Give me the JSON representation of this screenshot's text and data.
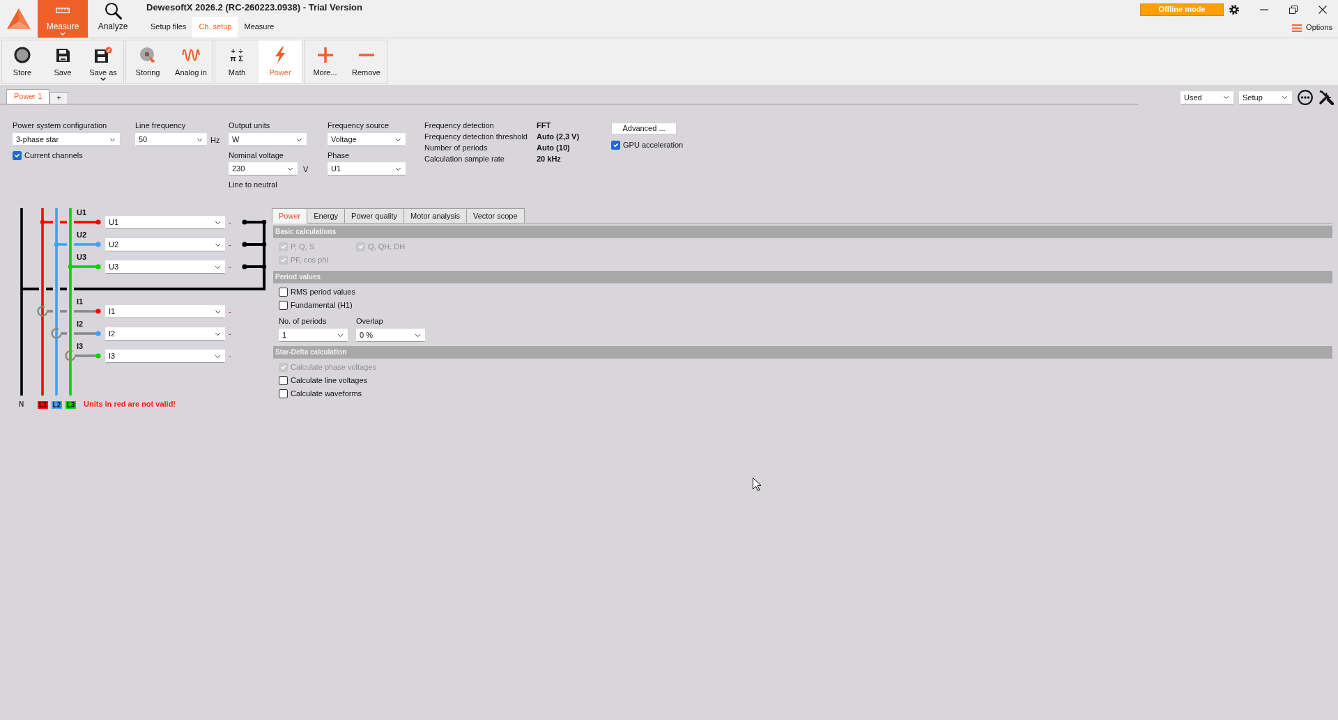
{
  "window": {
    "title": "DewesoftX 2026.2 (RC-260223.0938) - Trial Version",
    "mode": "Offline mode"
  },
  "modes": [
    {
      "label": "Measure",
      "selected": true,
      "dropdown": true
    },
    {
      "label": "Analyze",
      "selected": false,
      "dropdown": false
    }
  ],
  "sub_tabs": [
    {
      "label": "Setup files",
      "selected": false
    },
    {
      "label": "Ch. setup",
      "selected": true
    },
    {
      "label": "Measure",
      "selected": false
    }
  ],
  "options": {
    "label": "Options"
  },
  "toolbar": [
    [
      {
        "label": "Store",
        "selected": false,
        "dropdown": false
      },
      {
        "label": "Save",
        "selected": false,
        "dropdown": false
      },
      {
        "label": "Save as",
        "selected": false,
        "dropdown": true
      }
    ],
    [
      {
        "label": "Storing",
        "selected": false,
        "dropdown": false
      },
      {
        "label": "Analog in",
        "selected": false,
        "dropdown": false
      }
    ],
    [
      {
        "label": "Math",
        "selected": false,
        "dropdown": false,
        "symbols": [
          "+",
          "÷",
          "π",
          "Σ"
        ]
      },
      {
        "label": "Power",
        "selected": true,
        "dropdown": false
      }
    ],
    [
      {
        "label": "More...",
        "selected": false,
        "dropdown": false
      },
      {
        "label": "Remove",
        "selected": false,
        "dropdown": false
      }
    ]
  ],
  "channel_tabs": [
    {
      "label": "Power 1",
      "selected": true
    },
    {
      "label": "+",
      "selected": false
    }
  ],
  "view_filters": [
    {
      "value": "Used"
    },
    {
      "value": "Setup"
    }
  ],
  "config": {
    "system": {
      "label": "Power system configuration",
      "value": "3-phase star"
    },
    "current_channels": {
      "label": "Current channels",
      "checked": true
    },
    "line_frequency": {
      "label": "Line frequency",
      "value": "50",
      "unit": "Hz"
    },
    "output_units": {
      "label": "Output units",
      "value": "W"
    },
    "nominal_voltage": {
      "label": "Nominal voltage",
      "value": "230",
      "unit": "V",
      "note": "Line to neutral"
    },
    "frequency_source": {
      "label": "Frequency source",
      "value": "Voltage"
    },
    "phase": {
      "label": "Phase",
      "value": "U1"
    },
    "info": [
      {
        "label": "Frequency detection",
        "value": "FFT"
      },
      {
        "label": "Frequency detection threshold",
        "value": "Auto (2,3 V)"
      },
      {
        "label": "Number of periods",
        "value": "Auto (10)"
      },
      {
        "label": "Calculation sample rate",
        "value": "20 kHz"
      }
    ],
    "advanced": {
      "label": "Advanced ..."
    },
    "gpu_acceleration": {
      "label": "GPU acceleration",
      "checked": true
    }
  },
  "diagram": {
    "neutral": {
      "label": "N"
    },
    "phases": [
      {
        "label": "L1",
        "color": "#ff0000"
      },
      {
        "label": "L2",
        "color": "#3f9fff"
      },
      {
        "label": "L3",
        "color": "#00d200"
      }
    ],
    "voltages": [
      {
        "label": "U1",
        "value": "U1",
        "status": "-"
      },
      {
        "label": "U2",
        "value": "U2",
        "status": "-"
      },
      {
        "label": "U3",
        "value": "U3",
        "status": "-"
      }
    ],
    "currents": [
      {
        "label": "I1",
        "value": "I1",
        "status": "-"
      },
      {
        "label": "I2",
        "value": "I2",
        "status": "-"
      },
      {
        "label": "I3",
        "value": "I3",
        "status": "-"
      }
    ],
    "warning": "Units in red are not valid!"
  },
  "calc_tabs": [
    {
      "label": "Power",
      "selected": true
    },
    {
      "label": "Energy",
      "selected": false
    },
    {
      "label": "Power quality",
      "selected": false
    },
    {
      "label": "Motor analysis",
      "selected": false
    },
    {
      "label": "Vector scope",
      "selected": false
    }
  ],
  "sections": [
    {
      "title": "Basic calculations",
      "rows": [
        [
          {
            "kind": "checkbox",
            "label": "P, Q, S",
            "checked": true,
            "disabled": true
          },
          {
            "kind": "checkbox",
            "label": "Q, QH, DH",
            "checked": true,
            "disabled": true
          }
        ],
        [
          {
            "kind": "checkbox",
            "label": "PF, cos phi",
            "checked": true,
            "disabled": true
          }
        ]
      ]
    },
    {
      "title": "Period values",
      "rows": [
        [
          {
            "kind": "checkbox",
            "label": "RMS period values",
            "checked": false,
            "disabled": false
          }
        ],
        [
          {
            "kind": "checkbox",
            "label": "Fundamental (H1)",
            "checked": false,
            "disabled": false
          }
        ],
        [
          {
            "kind": "select",
            "label": "No. of periods",
            "value": "1"
          },
          {
            "kind": "select",
            "label": "Overlap",
            "value": "0 %"
          }
        ]
      ]
    },
    {
      "title": "Star-Delta calculation",
      "rows": [
        [
          {
            "kind": "checkbox",
            "label": "Calculate phase voltages",
            "checked": true,
            "disabled": true
          }
        ],
        [
          {
            "kind": "checkbox",
            "label": "Calculate line voltages",
            "checked": false,
            "disabled": false
          }
        ],
        [
          {
            "kind": "checkbox",
            "label": "Calculate waveforms",
            "checked": false,
            "disabled": false
          }
        ]
      ]
    }
  ]
}
